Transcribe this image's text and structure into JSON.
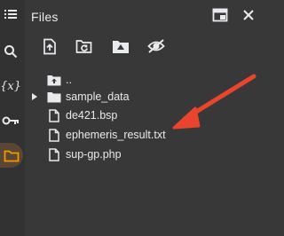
{
  "panel": {
    "title": "Files"
  },
  "rail": {
    "variables_label": "{x}"
  },
  "tree": {
    "items": [
      {
        "name": "..",
        "type": "parent"
      },
      {
        "name": "sample_data",
        "type": "folder"
      },
      {
        "name": "de421.bsp",
        "type": "file"
      },
      {
        "name": "ephemeris_result.txt",
        "type": "file"
      },
      {
        "name": "sup-gp.php",
        "type": "file"
      }
    ]
  },
  "colors": {
    "background": "#383838",
    "rail": "#323232",
    "active_accent": "#f29900",
    "annotation_arrow": "#e8452c",
    "text": "#e8eaed"
  },
  "icons": {
    "rail": [
      "table-of-contents-icon",
      "search-icon",
      "variables-icon",
      "secrets-key-icon",
      "files-folder-icon"
    ],
    "header": [
      "new-window-icon",
      "close-icon"
    ],
    "toolbar": [
      "upload-file-icon",
      "refresh-icon",
      "mount-drive-icon",
      "hide-icon"
    ]
  }
}
